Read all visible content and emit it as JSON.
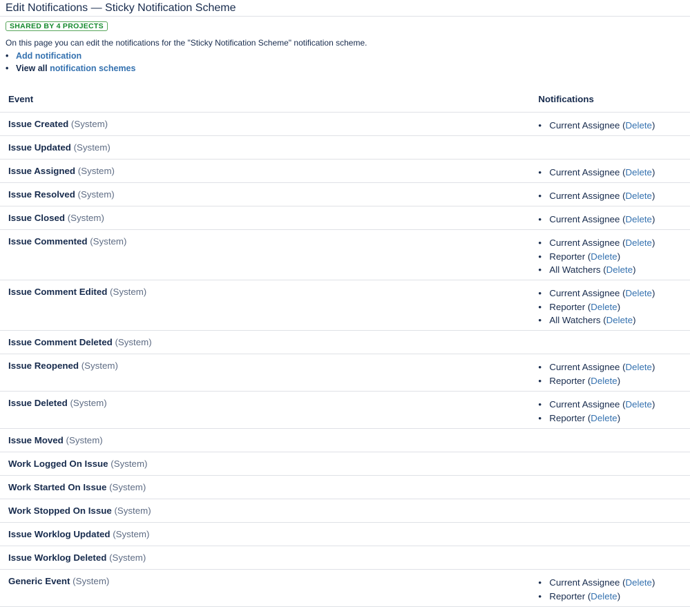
{
  "header": {
    "title": "Edit Notifications — Sticky Notification Scheme",
    "badge": "SHARED BY 4 PROJECTS"
  },
  "intro": "On this page you can edit the notifications for the \"Sticky Notification Scheme\" notification scheme.",
  "actions": {
    "add_notification": "Add notification",
    "view_all_prefix": "View all",
    "notification_schemes": "notification schemes"
  },
  "table": {
    "col_event": "Event",
    "col_notifications": "Notifications"
  },
  "events": [
    {
      "name": "Issue Created",
      "type": "(System)",
      "notifications": [
        "Current Assignee"
      ]
    },
    {
      "name": "Issue Updated",
      "type": "(System)",
      "notifications": []
    },
    {
      "name": "Issue Assigned",
      "type": "(System)",
      "notifications": [
        "Current Assignee"
      ]
    },
    {
      "name": "Issue Resolved",
      "type": "(System)",
      "notifications": [
        "Current Assignee"
      ]
    },
    {
      "name": "Issue Closed",
      "type": "(System)",
      "notifications": [
        "Current Assignee"
      ]
    },
    {
      "name": "Issue Commented",
      "type": "(System)",
      "notifications": [
        "Current Assignee",
        "Reporter",
        "All Watchers"
      ]
    },
    {
      "name": "Issue Comment Edited",
      "type": "(System)",
      "notifications": [
        "Current Assignee",
        "Reporter",
        "All Watchers"
      ]
    },
    {
      "name": "Issue Comment Deleted",
      "type": "(System)",
      "notifications": []
    },
    {
      "name": "Issue Reopened",
      "type": "(System)",
      "notifications": [
        "Current Assignee",
        "Reporter"
      ]
    },
    {
      "name": "Issue Deleted",
      "type": "(System)",
      "notifications": [
        "Current Assignee",
        "Reporter"
      ]
    },
    {
      "name": "Issue Moved",
      "type": "(System)",
      "notifications": []
    },
    {
      "name": "Work Logged On Issue",
      "type": "(System)",
      "notifications": []
    },
    {
      "name": "Work Started On Issue",
      "type": "(System)",
      "notifications": []
    },
    {
      "name": "Work Stopped On Issue",
      "type": "(System)",
      "notifications": []
    },
    {
      "name": "Issue Worklog Updated",
      "type": "(System)",
      "notifications": []
    },
    {
      "name": "Issue Worklog Deleted",
      "type": "(System)",
      "notifications": []
    },
    {
      "name": "Generic Event",
      "type": "(System)",
      "notifications": [
        "Current Assignee",
        "Reporter"
      ]
    }
  ],
  "delete_label": "Delete",
  "colors": {
    "link": "#3572b0",
    "text": "#172b4d",
    "muted": "#5e6c84",
    "border": "#dfe1e6",
    "badge": "#14892c"
  }
}
